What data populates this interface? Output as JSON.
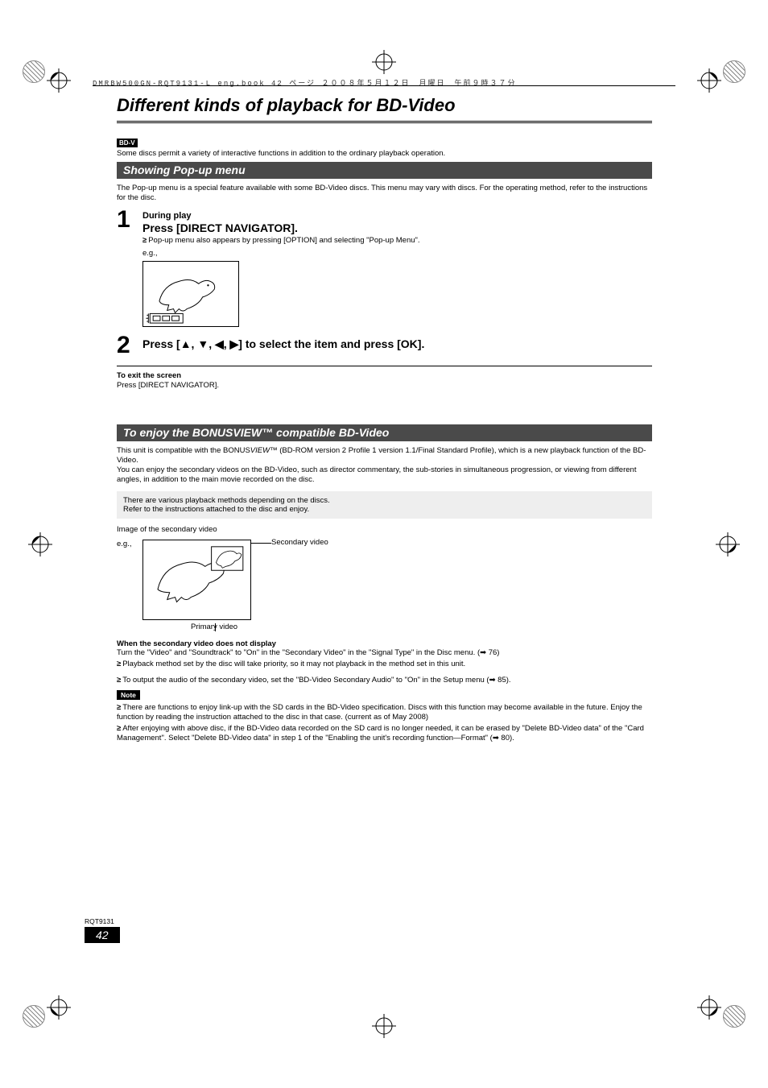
{
  "header_line": "DMRBW500GN-RQT9131-L_eng.book  42 ページ  ２００８年５月１２日　月曜日　午前９時３７分",
  "title": "Different kinds of playback for BD-Video",
  "badge_bd": "BD-V",
  "intro": "Some discs permit a variety of interactive functions in addition to the ordinary playback operation.",
  "section1": {
    "heading": "Showing Pop-up menu",
    "desc": "The Pop-up menu is a special feature available with some BD-Video discs. This menu may vary with discs. For the operating method, refer to the instructions for the disc.",
    "step1": {
      "num": "1",
      "line1": "During play",
      "line2": "Press [DIRECT NAVIGATOR].",
      "bullet": "Pop-up menu also appears by pressing [OPTION] and selecting \"Pop-up Menu\".",
      "eg": "e.g.,"
    },
    "step2": {
      "num": "2",
      "line2": "Press [▲, ▼, ◀, ▶] to select the item and press [OK]."
    },
    "exit_title": "To exit the screen",
    "exit_body": "Press [DIRECT NAVIGATOR]."
  },
  "section2": {
    "heading_pre": "To enjoy the BONUS",
    "heading_view": "VIEW",
    "heading_tm": "™ compatible BD-Video",
    "desc1_a": "This unit is compatible with the BONUS",
    "desc1_b": "VIEW",
    "desc1_c": "™ (BD-ROM version 2 Profile 1 version 1.1/Final Standard Profile), which is a new playback function of the BD-Video.",
    "desc2": "You can enjoy the secondary videos on the BD-Video, such as director commentary, the sub-stories in simultaneous progression, or viewing from different angles, in addition to the main movie recorded on the disc.",
    "note_box1": "There are various playback methods depending on the discs.",
    "note_box2": "Refer to the instructions attached to the disc and enjoy.",
    "image_label": "Image of the secondary video",
    "eg": "e.g.,",
    "secondary_label": "Secondary video",
    "primary_label": "Primary video",
    "when_title": "When the secondary video does not display",
    "when_body": "Turn the \"Video\" and \"Soundtrack\" to \"On\" in the \"Secondary Video\" in the \"Signal Type\" in the Disc menu. (➡ 76)",
    "when_bullet": "Playback method set by the disc will take priority, so it may not playback in the method set in this unit.",
    "output_bullet": "To output the audio of the secondary video, set the \"BD-Video Secondary Audio\" to \"On\" in the Setup menu (➡ 85).",
    "note_badge": "Note",
    "note_bullet1": "There are functions to enjoy link-up with the SD cards in the BD-Video specification. Discs with this function may become available in the future. Enjoy the function by reading the instruction attached to the disc in that case. (current as of May 2008)",
    "note_bullet2": "After enjoying with above disc, if the BD-Video data recorded on the SD card is no longer needed, it can be erased by \"Delete BD-Video data\" of the \"Card Management\". Select \"Delete BD-Video data\" in step 1 of the \"Enabling the unit's recording function—Format\" (➡ 80)."
  },
  "footer": {
    "rqt": "RQT9131",
    "page": "42"
  }
}
